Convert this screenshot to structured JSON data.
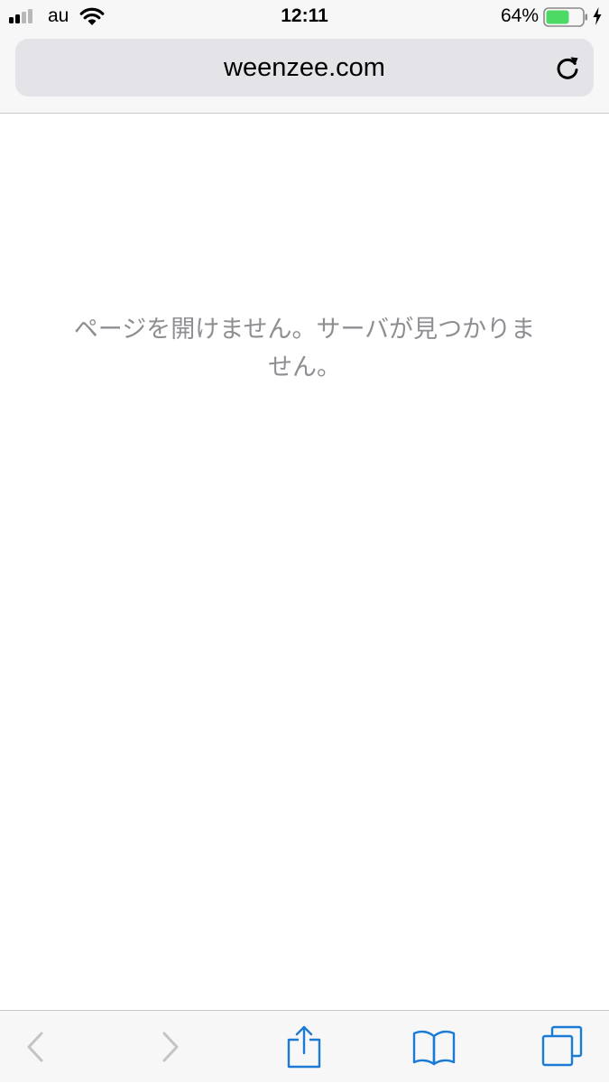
{
  "status_bar": {
    "carrier": "au",
    "time": "12:11",
    "battery_percent": "64%",
    "battery_level": 0.64,
    "signal_bars": 2,
    "icons": [
      "signal-icon",
      "wifi-icon",
      "battery-icon",
      "charging-bolt-icon"
    ]
  },
  "address_bar": {
    "url": "weenzee.com",
    "reload_icon": "reload-icon"
  },
  "content": {
    "error_message": "ページを開けません。サーバが見つかりません。"
  },
  "toolbar": {
    "items": [
      {
        "icon": "back-chevron-icon",
        "enabled": false
      },
      {
        "icon": "forward-chevron-icon",
        "enabled": false
      },
      {
        "icon": "share-icon",
        "enabled": true
      },
      {
        "icon": "bookmarks-book-icon",
        "enabled": true
      },
      {
        "icon": "tabs-icon",
        "enabled": true
      }
    ]
  },
  "colors": {
    "accent": "#1a7bd6",
    "disabled": "#c4c4c8",
    "message": "#8e8e93",
    "battery_fill": "#4cd964",
    "chrome_bg": "#f7f7f7",
    "address_bg": "#e3e3e8"
  }
}
